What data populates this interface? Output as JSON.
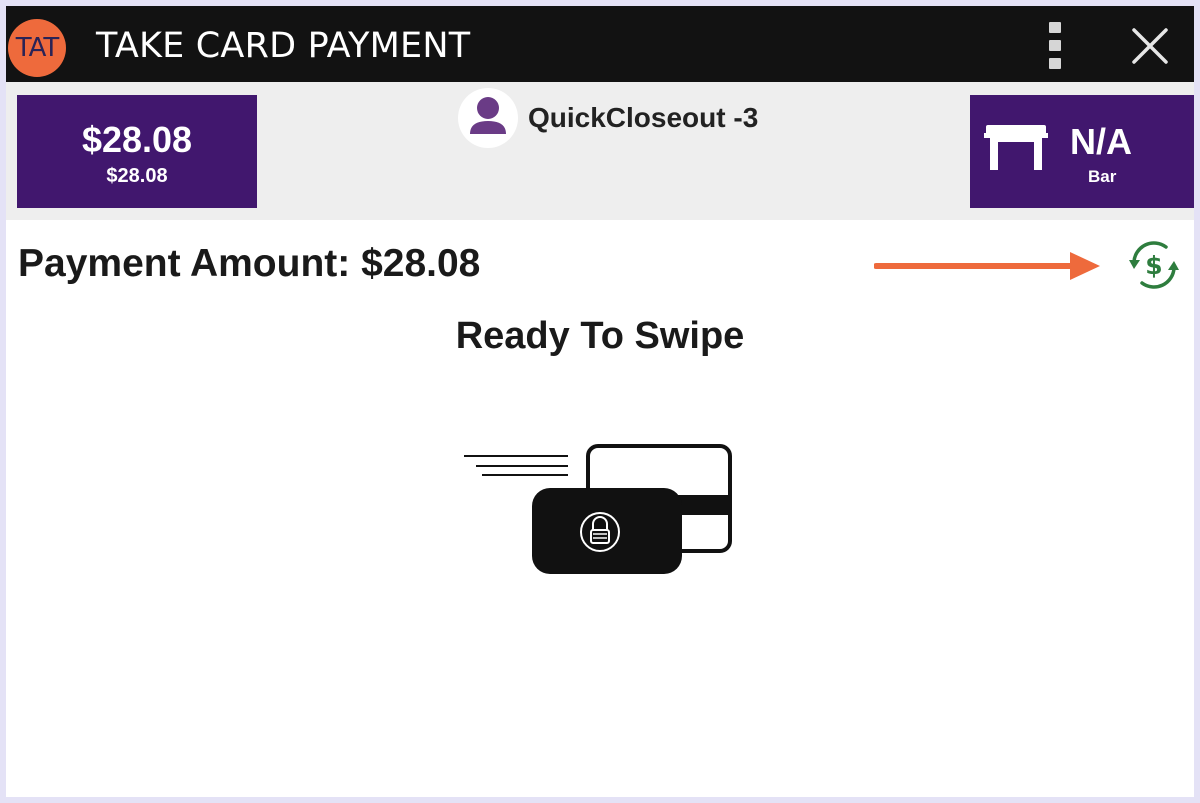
{
  "app": {
    "logo_text": "TAT",
    "title": "TAKE CARD PAYMENT"
  },
  "icons": {
    "logo": "tat-logo-icon",
    "menu": "kebab-menu-icon",
    "close": "close-icon",
    "avatar": "user-avatar-icon",
    "table": "table-icon",
    "currency_swap": "currency-exchange-icon",
    "card_swipe": "card-swipe-illustration"
  },
  "order": {
    "total": "$28.08",
    "subtotal": "$28.08",
    "customer_name": "QuickCloseout -3",
    "table_name": "N/A",
    "table_area": "Bar"
  },
  "payment": {
    "amount_label": "Payment Amount: $28.08",
    "status": "Ready To Swipe"
  },
  "colors": {
    "titlebar": "#121212",
    "brand_purple": "#41176e",
    "logo_orange": "#ee6a3c",
    "arrow_orange": "#ee6a3c",
    "currency_green": "#2e7d3e",
    "avatar_purple": "#6a3b86"
  }
}
